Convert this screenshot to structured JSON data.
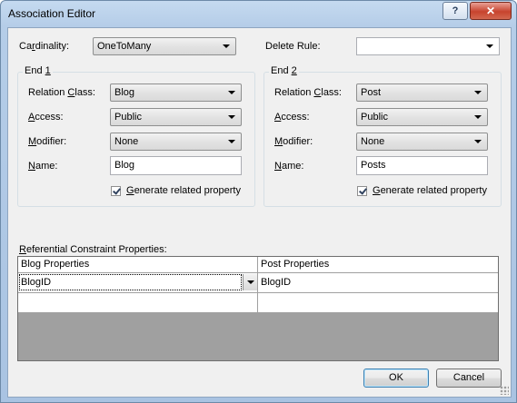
{
  "window": {
    "title": "Association Editor",
    "help_glyph": "?",
    "close_glyph": "✕"
  },
  "top": {
    "cardinality_label": "Cardinality:",
    "cardinality_value": "OneToMany",
    "delete_rule_label": "Delete Rule:",
    "delete_rule_value": ""
  },
  "end1": {
    "title": "End 1",
    "relation_class_label": "Relation Class:",
    "relation_class_value": "Blog",
    "access_label": "Access:",
    "access_value": "Public",
    "modifier_label": "Modifier:",
    "modifier_value": "None",
    "name_label": "Name:",
    "name_value": "Blog",
    "generate_label": "Generate related property",
    "generate_checked": true
  },
  "end2": {
    "title": "End 2",
    "relation_class_label": "Relation Class:",
    "relation_class_value": "Post",
    "access_label": "Access:",
    "access_value": "Public",
    "modifier_label": "Modifier:",
    "modifier_value": "None",
    "name_label": "Name:",
    "name_value": "Posts",
    "generate_label": "Generate related property",
    "generate_checked": true
  },
  "constraints": {
    "label": "Referential Constraint Properties:",
    "columns": [
      "Blog Properties",
      "Post Properties"
    ],
    "rows": [
      [
        "BlogID",
        "BlogID"
      ],
      [
        "",
        ""
      ]
    ]
  },
  "buttons": {
    "ok": "OK",
    "cancel": "Cancel"
  }
}
